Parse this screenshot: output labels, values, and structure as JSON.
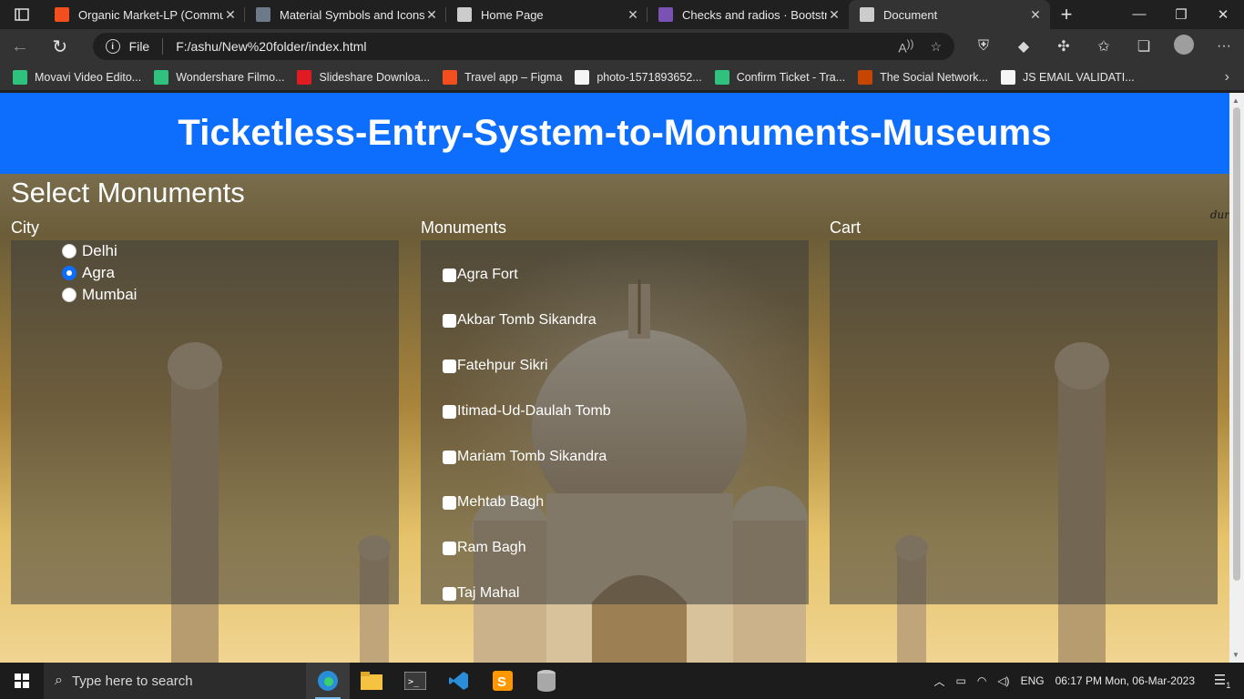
{
  "browser": {
    "tabs": [
      {
        "title": "Organic Market-LP (Commun",
        "favicon": "figma-icon",
        "color": "#f24e1e",
        "active": false
      },
      {
        "title": "Material Symbols and Icons -",
        "favicon": "material-icon",
        "color": "#6c7a89",
        "active": false
      },
      {
        "title": "Home Page",
        "favicon": "page-icon",
        "color": "#cccccc",
        "active": false
      },
      {
        "title": "Checks and radios · Bootstrap",
        "favicon": "bootstrap-icon",
        "color": "#7952b3",
        "active": false
      },
      {
        "title": "Document",
        "favicon": "page-icon",
        "color": "#cccccc",
        "active": true
      }
    ],
    "address": {
      "scheme": "File",
      "url": "F:/ashu/New%20folder/index.html"
    },
    "bookmarks": [
      {
        "label": "Movavi Video Edito...",
        "icon": "movavi-icon",
        "color": "#2ec27e"
      },
      {
        "label": "Wondershare Filmo...",
        "icon": "filmora-icon",
        "color": "#2ec27e"
      },
      {
        "label": "Slideshare Downloa...",
        "icon": "slideshare-icon",
        "color": "#e01b24"
      },
      {
        "label": "Travel app – Figma",
        "icon": "figma-icon",
        "color": "#f24e1e"
      },
      {
        "label": "photo-1571893652...",
        "icon": "unsplash-icon",
        "color": "#ffffff"
      },
      {
        "label": "Confirm Ticket - Tra...",
        "icon": "confirmtkt-icon",
        "color": "#2ec27e"
      },
      {
        "label": "The Social Network...",
        "icon": "social-icon",
        "color": "#c64600"
      },
      {
        "label": "JS EMAIL VALIDATI...",
        "icon": "w3schools-icon",
        "color": "#ffffff"
      }
    ]
  },
  "page": {
    "header": "Ticketless-Entry-System-to-Monuments-Museums",
    "section_title": "Select Monuments",
    "watermark": "dur",
    "city": {
      "label": "City",
      "options": [
        {
          "label": "Delhi",
          "checked": false
        },
        {
          "label": "Agra",
          "checked": true
        },
        {
          "label": "Mumbai",
          "checked": false
        }
      ]
    },
    "monuments": {
      "label": "Monuments",
      "items": [
        "Agra Fort",
        "Akbar Tomb Sikandra",
        "Fatehpur Sikri",
        "Itimad-Ud-Daulah Tomb",
        "Mariam Tomb Sikandra",
        "Mehtab Bagh",
        "Ram Bagh",
        "Taj Mahal"
      ]
    },
    "cart": {
      "label": "Cart"
    }
  },
  "taskbar": {
    "search_placeholder": "Type here to search",
    "language": "ENG",
    "clock": "06:17 PM Mon, 06-Mar-2023",
    "notification_count": "1"
  }
}
